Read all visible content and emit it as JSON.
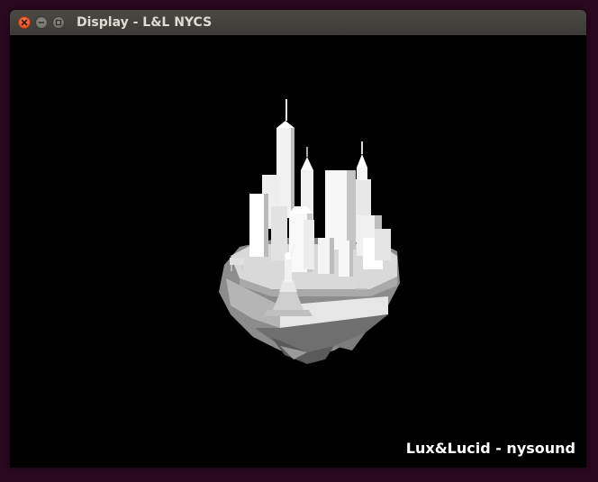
{
  "window": {
    "title": "Display - L&L NYCS",
    "buttons": {
      "close": "close-icon",
      "minimize": "minimize-icon",
      "maximize": "maximize-icon"
    }
  },
  "viewport": {
    "background": "#000000",
    "scene": "floating-island-city-model",
    "watermark": "Lux&Lucid - nysound"
  },
  "colors": {
    "titlebar": "#3c3b37",
    "close_button": "#df4a16",
    "title_text": "#dfdbd2",
    "desktop": "#2a0820"
  }
}
